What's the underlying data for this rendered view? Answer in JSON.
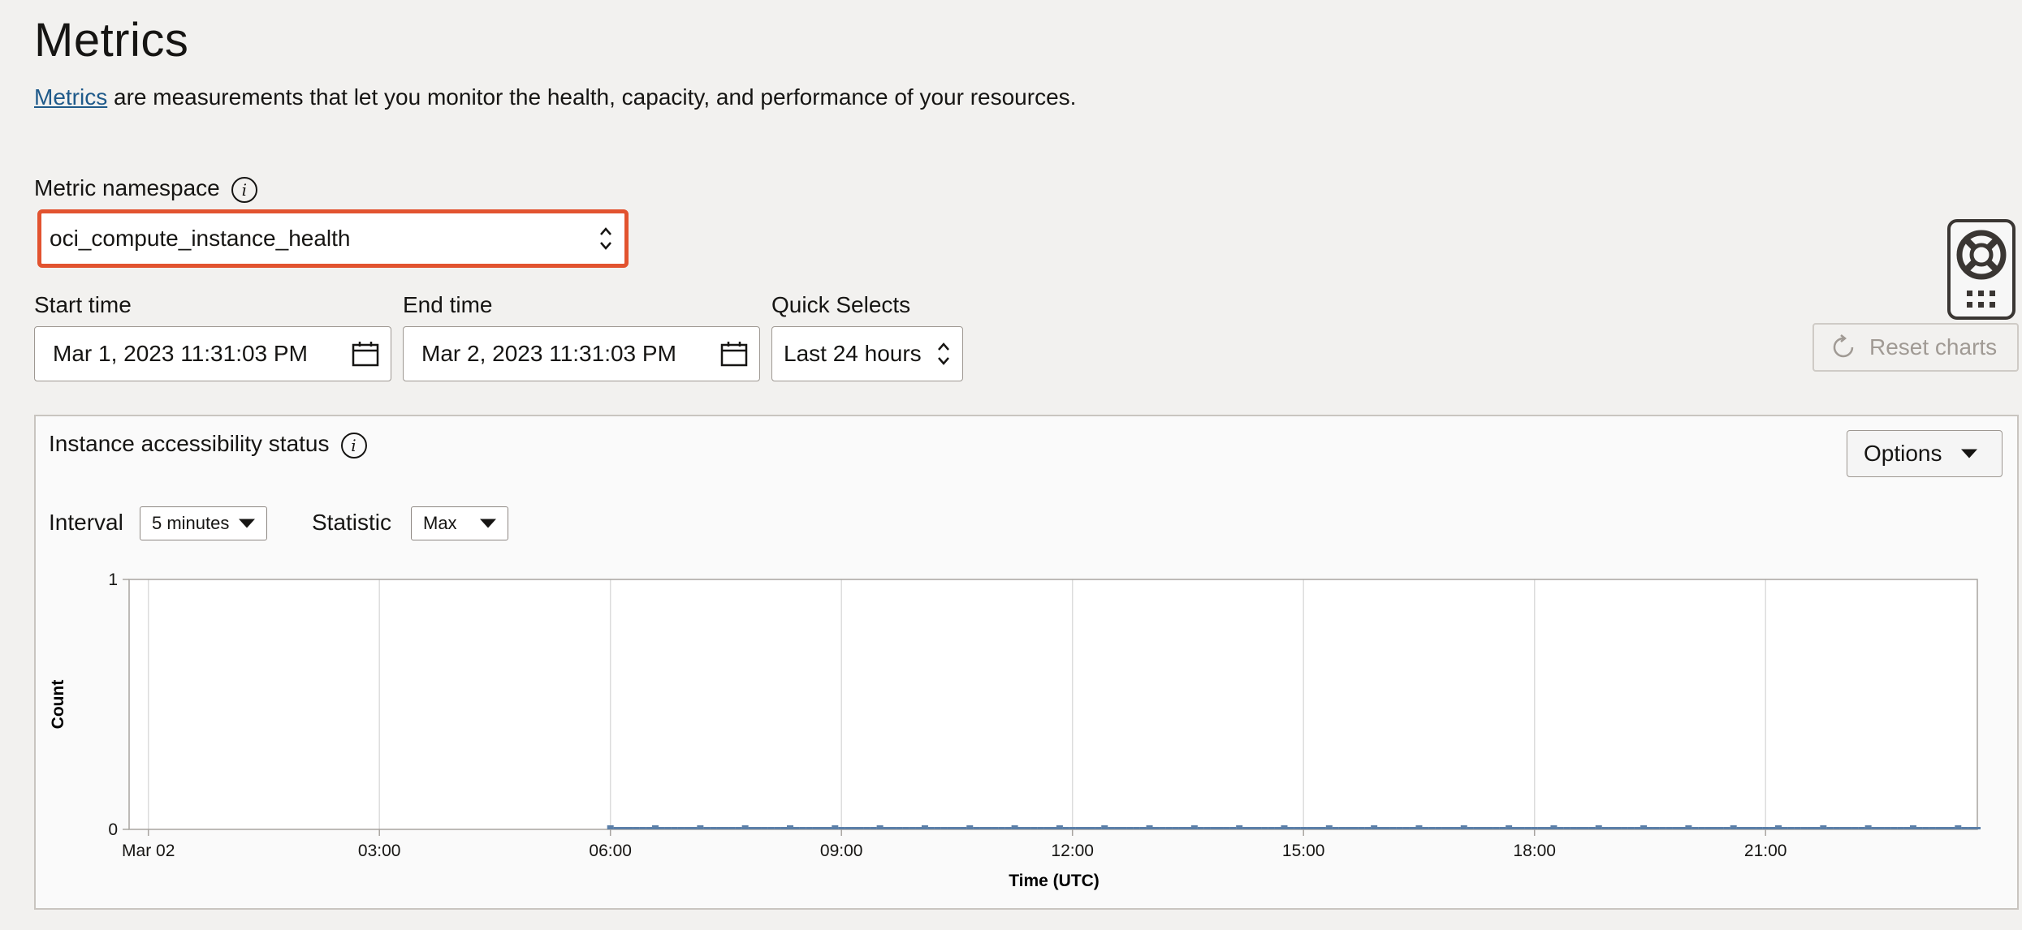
{
  "header": {
    "title": "Metrics",
    "description_link": "Metrics",
    "description_rest": " are measurements that let you monitor the health, capacity, and performance of your resources."
  },
  "namespace": {
    "label": "Metric namespace",
    "value": "oci_compute_instance_health"
  },
  "time_range": {
    "start_label": "Start time",
    "start_value": "Mar 1, 2023 11:31:03 PM",
    "end_label": "End time",
    "end_value": "Mar 2, 2023 11:31:03 PM",
    "quick_label": "Quick Selects",
    "quick_value": "Last 24 hours"
  },
  "reset_button": "Reset charts",
  "chart_panel": {
    "title": "Instance accessibility status",
    "options_button": "Options",
    "interval_label": "Interval",
    "interval_value": "5 minutes",
    "statistic_label": "Statistic",
    "statistic_value": "Max"
  },
  "colors": {
    "accent_border": "#e2532f",
    "link": "#1f5a8a",
    "series": "#5b7fa8"
  },
  "chart_data": {
    "type": "bar",
    "xlabel": "Time (UTC)",
    "ylabel": "Count",
    "ylim": [
      0,
      1
    ],
    "y_ticks": [
      "1",
      "0"
    ],
    "x_ticks": [
      "Mar 02",
      "03:00",
      "06:00",
      "09:00",
      "12:00",
      "15:00",
      "18:00",
      "21:00"
    ],
    "x_range_hours": [
      -0.25,
      23.75
    ],
    "series": [
      {
        "interval_minutes": 5,
        "start_hour": 6.0,
        "end_hour": 23.75,
        "values": "0 for every 5-minute interval from 06:00 to the end of the range"
      }
    ],
    "grid": true
  }
}
